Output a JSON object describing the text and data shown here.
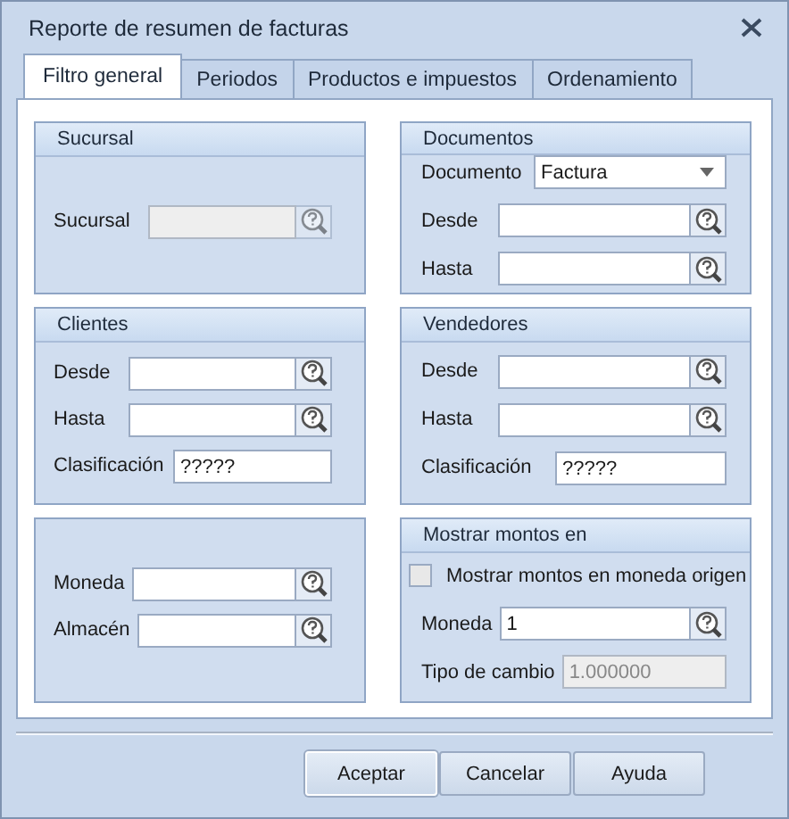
{
  "window": {
    "title": "Reporte de resumen de facturas"
  },
  "tabs": [
    {
      "label": "Filtro general",
      "selected": true
    },
    {
      "label": "Periodos",
      "selected": false
    },
    {
      "label": "Productos e impuestos",
      "selected": false
    },
    {
      "label": "Ordenamiento",
      "selected": false
    }
  ],
  "columns": [
    {
      "groups": [
        {
          "title": "Sucursal",
          "fields": [
            {
              "kind": "lookup",
              "label": "Sucursal",
              "disabled": true
            }
          ]
        },
        {
          "title": "Clientes",
          "fields": [
            {
              "kind": "lookup",
              "label": "Desde",
              "disabled": false
            },
            {
              "kind": "lookup",
              "label": "Hasta",
              "disabled": false
            },
            {
              "kind": "text",
              "label": "Clasificación",
              "value": "?????",
              "disabled": false
            }
          ]
        },
        {
          "fields": [
            {
              "kind": "lookup",
              "label": "Moneda",
              "disabled": false
            },
            {
              "kind": "lookup",
              "label": "Almacén",
              "disabled": false
            }
          ]
        }
      ]
    },
    {
      "groups": [
        {
          "title": "Documentos",
          "fields": [
            {
              "kind": "combo",
              "label": "Documento",
              "value": "Factura",
              "disabled": false
            },
            {
              "kind": "lookup",
              "label": "Desde",
              "disabled": false
            },
            {
              "kind": "lookup",
              "label": "Hasta",
              "disabled": false
            }
          ]
        },
        {
          "title": "Vendedores",
          "fields": [
            {
              "kind": "lookup",
              "label": "Desde",
              "disabled": false
            },
            {
              "kind": "lookup",
              "label": "Hasta",
              "disabled": false
            },
            {
              "kind": "text",
              "label": "Clasificación",
              "value": "?????",
              "disabled": false
            }
          ]
        },
        {
          "title": "Mostrar montos en",
          "fields": [
            {
              "kind": "checkbox",
              "label": "Mostrar montos en moneda origen",
              "checked": false
            },
            {
              "kind": "lookup",
              "label": "Moneda",
              "value": "1",
              "disabled": false
            },
            {
              "kind": "text",
              "label": "Tipo de cambio",
              "value": "1.000000",
              "disabled": true
            }
          ]
        }
      ]
    }
  ],
  "buttons": [
    {
      "label": "Aceptar",
      "default": true
    },
    {
      "label": "Cancelar",
      "default": false
    },
    {
      "label": "Ayuda",
      "default": false
    }
  ]
}
